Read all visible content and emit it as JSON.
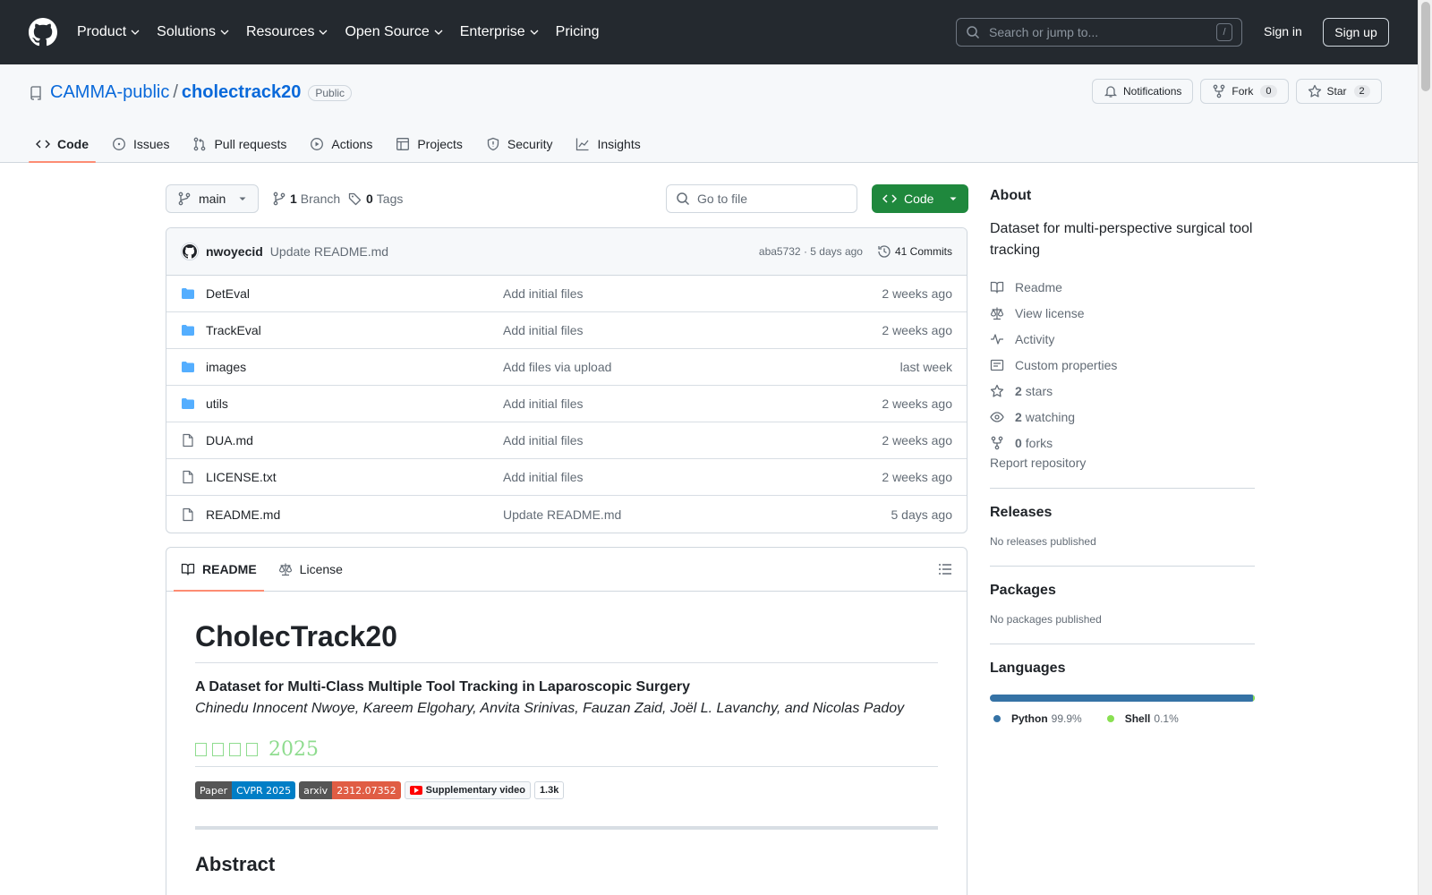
{
  "header": {
    "nav": [
      "Product",
      "Solutions",
      "Resources",
      "Open Source",
      "Enterprise",
      "Pricing"
    ],
    "search_placeholder": "Search or jump to...",
    "search_key": "/",
    "sign_in": "Sign in",
    "sign_up": "Sign up"
  },
  "repo": {
    "owner": "CAMMA-public",
    "separator": "/",
    "name": "cholectrack20",
    "visibility": "Public",
    "notifications_label": "Notifications",
    "fork_label": "Fork",
    "fork_count": "0",
    "star_label": "Star",
    "star_count": "2"
  },
  "tabs": [
    {
      "label": "Code",
      "icon": "code-icon"
    },
    {
      "label": "Issues",
      "icon": "issue-icon"
    },
    {
      "label": "Pull requests",
      "icon": "pull-request-icon"
    },
    {
      "label": "Actions",
      "icon": "play-icon"
    },
    {
      "label": "Projects",
      "icon": "table-icon"
    },
    {
      "label": "Security",
      "icon": "shield-icon"
    },
    {
      "label": "Insights",
      "icon": "graph-icon"
    }
  ],
  "toolbar": {
    "branch": "main",
    "branch_count": "1",
    "branch_label": "Branch",
    "tag_count": "0",
    "tag_label": "Tags",
    "goto_placeholder": "Go to file",
    "code_label": "Code"
  },
  "latest_commit": {
    "author": "nwoyecid",
    "message": "Update README.md",
    "meta": "aba5732 · 5 days ago",
    "commits_label": "41 Commits"
  },
  "files": [
    {
      "type": "folder",
      "name": "DetEval",
      "message": "Add initial files",
      "age": "2 weeks ago"
    },
    {
      "type": "folder",
      "name": "TrackEval",
      "message": "Add initial files",
      "age": "2 weeks ago"
    },
    {
      "type": "folder",
      "name": "images",
      "message": "Add files via upload",
      "age": "last week"
    },
    {
      "type": "folder",
      "name": "utils",
      "message": "Add initial files",
      "age": "2 weeks ago"
    },
    {
      "type": "file",
      "name": "DUA.md",
      "message": "Add initial files",
      "age": "2 weeks ago"
    },
    {
      "type": "file",
      "name": "LICENSE.txt",
      "message": "Add initial files",
      "age": "2 weeks ago"
    },
    {
      "type": "file",
      "name": "README.md",
      "message": "Update README.md",
      "age": "5 days ago"
    }
  ],
  "readme": {
    "tab_readme": "README",
    "tab_license": "License",
    "title": "CholecTrack20",
    "subtitle": "A Dataset for Multi-Class Multiple Tool Tracking in Laparoscopic Surgery",
    "authors": "Chinedu Innocent Nwoye, Kareem Elgohary, Anvita Srinivas, Fauzan Zaid, Joël L. Lavanchy, and Nicolas Padoy",
    "banner_year": "2025",
    "badge_paper_l": "Paper",
    "badge_paper_r": "CVPR 2025",
    "badge_arxiv_l": "arxiv",
    "badge_arxiv_r": "2312.07352",
    "badge_video": "Supplementary video",
    "badge_views": "1.3k",
    "abstract": "Abstract"
  },
  "about": {
    "title": "About",
    "description": "Dataset for multi-perspective surgical tool tracking",
    "readme": "Readme",
    "license": "View license",
    "activity": "Activity",
    "custom_properties": "Custom properties",
    "stars_count": "2",
    "stars_label": "stars",
    "watching_count": "2",
    "watching_label": "watching",
    "forks_count": "0",
    "forks_label": "forks",
    "report": "Report repository"
  },
  "releases": {
    "title": "Releases",
    "empty": "No releases published"
  },
  "packages": {
    "title": "Packages",
    "empty": "No packages published"
  },
  "languages": {
    "title": "Languages",
    "items": [
      {
        "name": "Python",
        "percent": "99.9%",
        "color": "#3572a5"
      },
      {
        "name": "Shell",
        "percent": "0.1%",
        "color": "#89e051"
      }
    ]
  },
  "colors": {
    "header_bg": "#24292f",
    "link": "#0969da",
    "primary_button": "#1f883d",
    "active_tab_underline": "#fd8c73"
  }
}
